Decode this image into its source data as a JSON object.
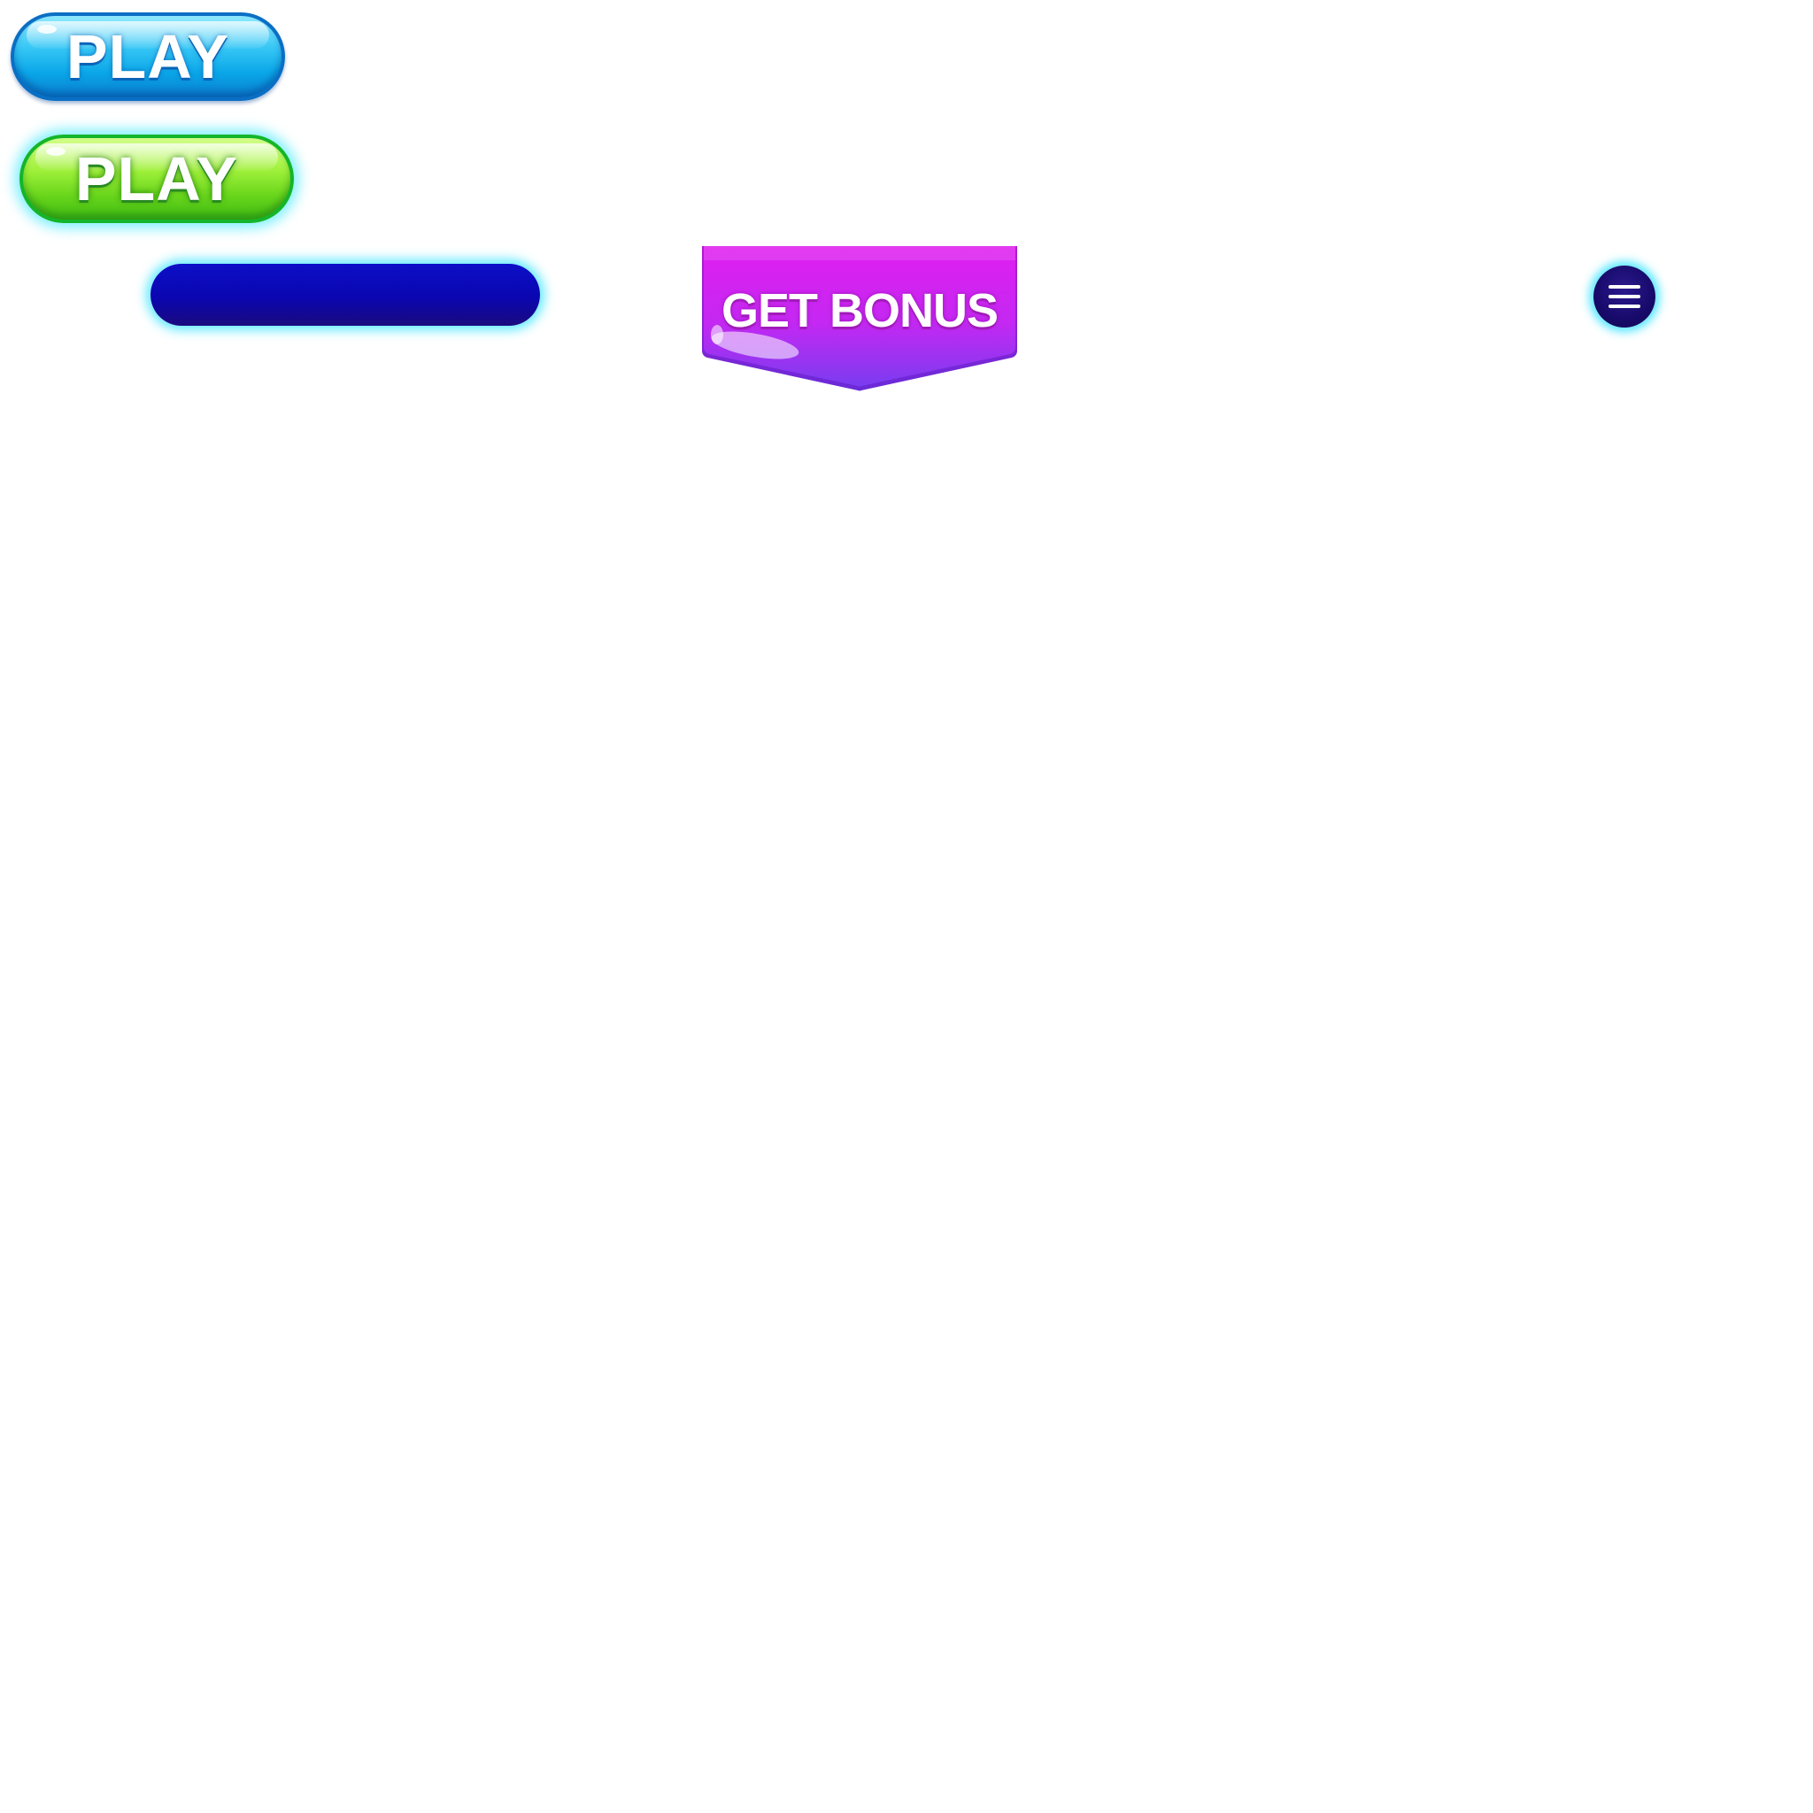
{
  "buttons": {
    "play_primary": {
      "label": "PLAY"
    },
    "play_hover": {
      "label": "PLAY"
    },
    "get_bonus": {
      "label": "GET BONUS"
    }
  },
  "icons": {
    "menu": "hamburger-menu-icon"
  },
  "colors": {
    "play_blue": "#1ab4ef",
    "play_green": "#7fe02a",
    "glow_cyan": "#46e6ff",
    "nav_bar": "#0a06b0",
    "bonus_magenta": "#e01ff0",
    "bonus_violet": "#7a3cf0",
    "menu_circle": "#170a6a"
  }
}
